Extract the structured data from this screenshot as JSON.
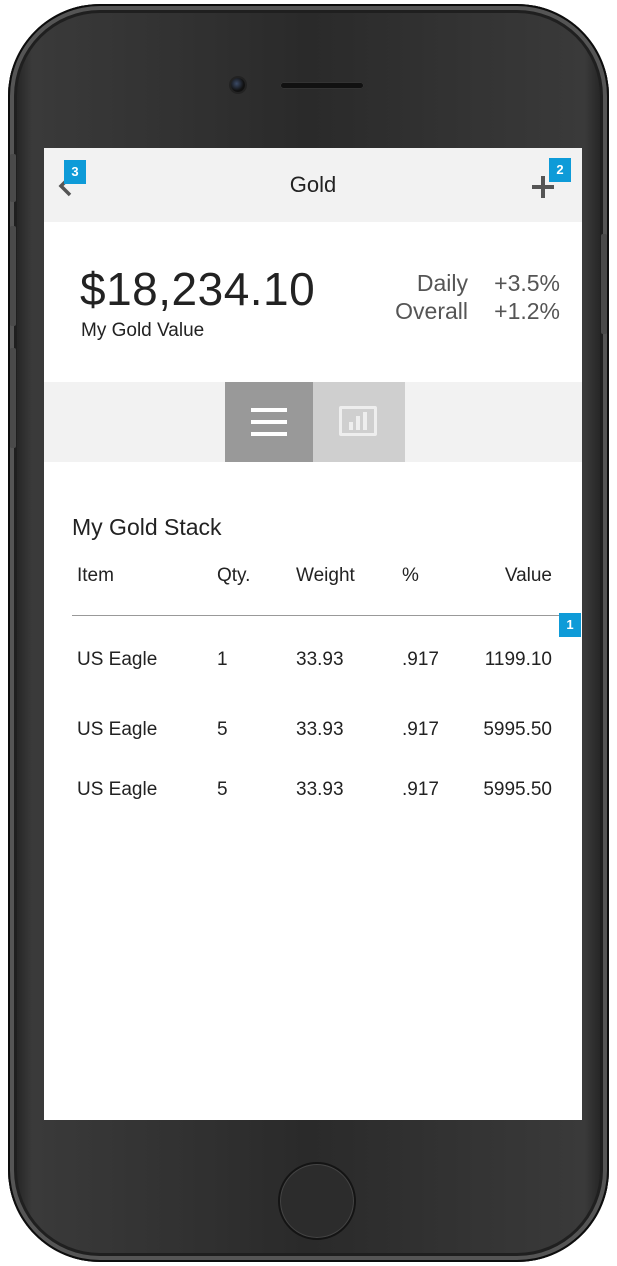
{
  "nav": {
    "title": "Gold",
    "back_icon": "chevron-left-icon",
    "add_icon": "plus-icon"
  },
  "summary": {
    "amount": "$18,234.10",
    "label": "My Gold Value",
    "daily_label": "Daily",
    "daily_value": "+3.5%",
    "overall_label": "Overall",
    "overall_value": "+1.2%"
  },
  "view_toggle": {
    "list_icon": "list-icon",
    "chart_icon": "bar-chart-icon",
    "selected": "list"
  },
  "stack": {
    "title": "My Gold Stack",
    "columns": [
      "Item",
      "Qty.",
      "Weight",
      "%",
      "Value"
    ],
    "rows": [
      [
        "US Eagle",
        "1",
        "33.93",
        ".917",
        "1199.10"
      ],
      [
        "US Eagle",
        "5",
        "33.93",
        ".917",
        "5995.50"
      ],
      [
        "US Eagle",
        "5",
        "33.93",
        ".917",
        "5995.50"
      ]
    ]
  },
  "annotations": {
    "badge_1": "1",
    "badge_2": "2",
    "badge_3": "3",
    "color": "#0e9bd8"
  },
  "colors": {
    "navbar_bg": "#f2f2f2",
    "toggle_active": "#999999",
    "toggle_inactive": "#cfcfcf"
  }
}
